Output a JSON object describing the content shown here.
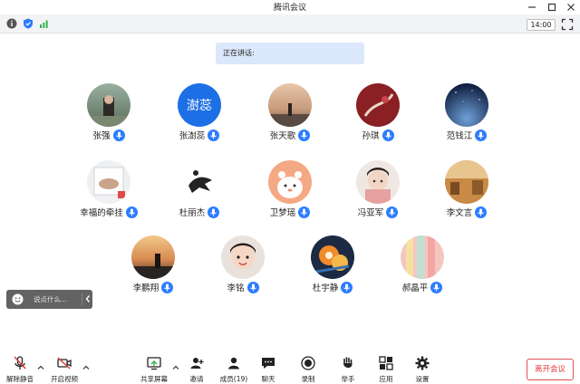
{
  "window": {
    "title": "腾讯会议"
  },
  "top_bar": {
    "time": "14:00"
  },
  "speaking_label": "正在讲话:",
  "participants": [
    {
      "name": "张强"
    },
    {
      "name": "张澍蕊",
      "avatar_text": "澍蕊"
    },
    {
      "name": "张天歌"
    },
    {
      "name": "孙琪"
    },
    {
      "name": "范钱江"
    },
    {
      "name": "幸福的牵挂"
    },
    {
      "name": "杜丽杰"
    },
    {
      "name": "卫梦瑶"
    },
    {
      "name": "冯亚军"
    },
    {
      "name": "李文言"
    },
    {
      "name": "李鹏翔"
    },
    {
      "name": "李铭"
    },
    {
      "name": "杜宇静"
    },
    {
      "name": "郝晶平"
    }
  ],
  "chat": {
    "placeholder": "说点什么..."
  },
  "toolbar": {
    "unmute": "解除静音",
    "start_video": "开启视频",
    "share_screen": "共享屏幕",
    "invite": "邀请",
    "members": "成员(19)",
    "chat": "聊天",
    "record": "录制",
    "raise_hand": "举手",
    "apps": "应用",
    "settings": "设置",
    "leave": "离开会议"
  },
  "colors": {
    "accent": "#2b7cff",
    "leave_red": "#e03a3a",
    "speaking_bg": "#dbe7fb"
  }
}
